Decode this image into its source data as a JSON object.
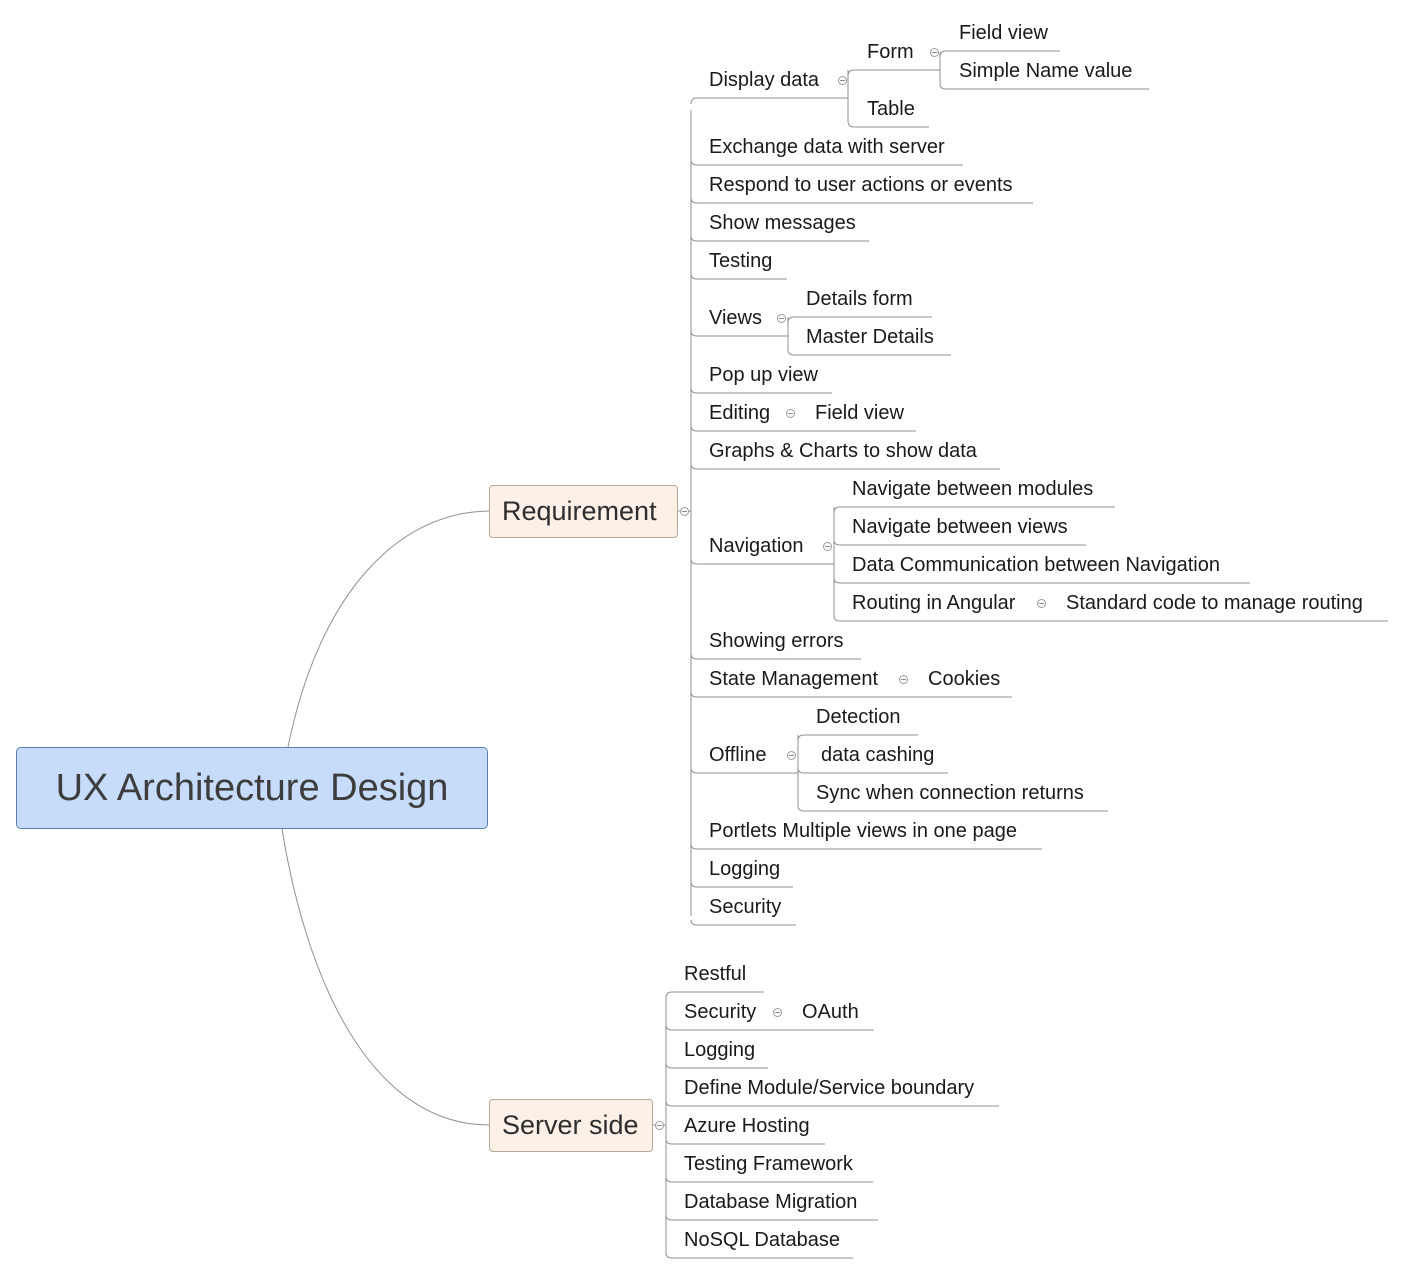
{
  "root": {
    "label": "UX Architecture Design"
  },
  "branches": {
    "requirement": {
      "label": "Requirement"
    },
    "server_side": {
      "label": "Server side"
    }
  },
  "requirement": {
    "display_data": "Display data",
    "form": "Form",
    "field_view": "Field view",
    "simple_name_value": "Simple Name value",
    "table": "Table",
    "exchange_data": "Exchange data with server",
    "respond_actions": "Respond to user actions or events",
    "show_messages": "Show messages",
    "testing": "Testing",
    "views": "Views",
    "details_form": "Details form",
    "master_details": "Master Details",
    "pop_up_view": "Pop up view",
    "editing": "Editing",
    "editing_field_view": "Field view",
    "graphs_charts": "Graphs & Charts to show data",
    "navigation": "Navigation",
    "nav_modules": "Navigate between modules",
    "nav_views": "Navigate between views",
    "nav_data_comm": "Data Communication between Navigation",
    "routing_angular": "Routing in Angular",
    "standard_code": "Standard code to manage routing",
    "showing_errors": "Showing errors",
    "state_management": "State Management",
    "cookies": "Cookies",
    "offline": "Offline",
    "detection": "Detection",
    "data_cashing": "data cashing",
    "sync_connection": "Sync when connection returns",
    "portlets": "Portlets Multiple views in one page",
    "logging": "Logging",
    "security": "Security"
  },
  "server": {
    "restful": "Restful",
    "security": "Security",
    "oauth": "OAuth",
    "logging": "Logging",
    "module_boundary": "Define Module/Service boundary",
    "azure_hosting": "Azure Hosting",
    "testing_framework": "Testing Framework",
    "db_migration": "Database Migration",
    "nosql_db": "NoSQL Database"
  },
  "colors": {
    "root_fill": "#c6dcfa",
    "root_border": "#5d7fb4",
    "branch_fill": "#fdf0e6",
    "branch_border": "#b8a898",
    "line": "#909090",
    "text": "#1a1a1a"
  }
}
